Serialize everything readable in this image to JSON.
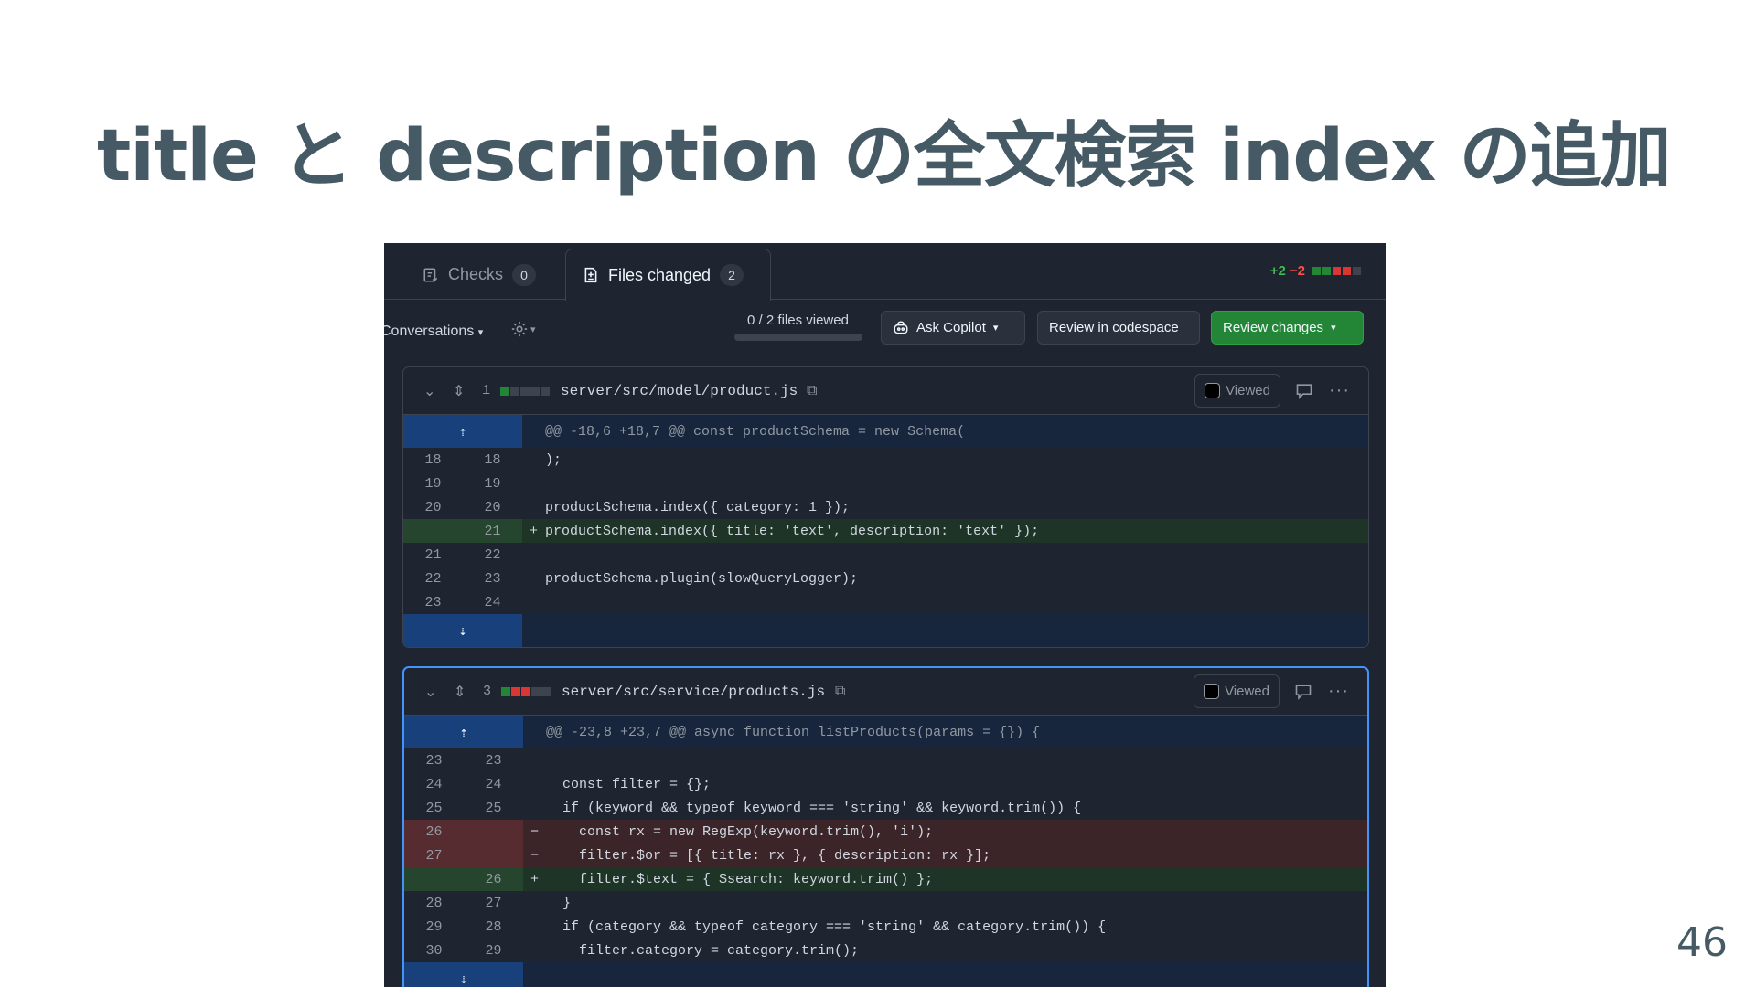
{
  "slide": {
    "title": "title と description の全文検索 index の追加",
    "page_number": "46"
  },
  "tabs": [
    {
      "label": "Checks",
      "count": "0",
      "icon": "checklist-icon"
    },
    {
      "label": "Files changed",
      "count": "2",
      "icon": "file-diff-icon"
    }
  ],
  "diffstat": {
    "additions": "+2",
    "deletions": "−2",
    "colors": {
      "add": "#238636",
      "del": "#da3633",
      "neutral": "#3d444d"
    }
  },
  "toolbar": {
    "conversations": "Conversations",
    "files_viewed": "0 / 2 files viewed",
    "files_viewed_fraction": 0,
    "ask_copilot": "Ask Copilot",
    "review_codespace": "Review in codespace",
    "review_changes": "Review changes",
    "accent": "#238636"
  },
  "files": [
    {
      "changes": "1",
      "path": "server/src/model/product.js",
      "viewed_label": "Viewed",
      "hunk": "@@ -18,6 +18,7 @@ const productSchema = new Schema(",
      "lines": [
        {
          "type": "ctx",
          "old": "18",
          "new": "18",
          "code": ");"
        },
        {
          "type": "ctx",
          "old": "19",
          "new": "19",
          "code": ""
        },
        {
          "type": "ctx",
          "old": "20",
          "new": "20",
          "code": "productSchema.index({ category: 1 });"
        },
        {
          "type": "add",
          "old": "",
          "new": "21",
          "code": "productSchema.index({ title: 'text', description: 'text' });"
        },
        {
          "type": "ctx",
          "old": "21",
          "new": "22",
          "code": ""
        },
        {
          "type": "ctx",
          "old": "22",
          "new": "23",
          "code": "productSchema.plugin(slowQueryLogger);"
        },
        {
          "type": "ctx",
          "old": "23",
          "new": "24",
          "code": ""
        }
      ]
    },
    {
      "changes": "3",
      "path": "server/src/service/products.js",
      "viewed_label": "Viewed",
      "hunk": "@@ -23,8 +23,7 @@ async function listProducts(params = {}) {",
      "lines": [
        {
          "type": "ctx",
          "old": "23",
          "new": "23",
          "code": ""
        },
        {
          "type": "ctx",
          "old": "24",
          "new": "24",
          "code": "  const filter = {};"
        },
        {
          "type": "ctx",
          "old": "25",
          "new": "25",
          "code": "  if (keyword && typeof keyword === 'string' && keyword.trim()) {"
        },
        {
          "type": "del",
          "old": "26",
          "new": "",
          "code": "    const rx = new RegExp(keyword.trim(), 'i');"
        },
        {
          "type": "del",
          "old": "27",
          "new": "",
          "code": "    filter.$or = [{ title: rx }, { description: rx }];"
        },
        {
          "type": "add",
          "old": "",
          "new": "26",
          "code": "    filter.$text = { $search: keyword.trim() };"
        },
        {
          "type": "ctx",
          "old": "28",
          "new": "27",
          "code": "  }"
        },
        {
          "type": "ctx",
          "old": "29",
          "new": "28",
          "code": "  if (category && typeof category === 'string' && category.trim()) {"
        },
        {
          "type": "ctx",
          "old": "30",
          "new": "29",
          "code": "    filter.category = category.trim();"
        }
      ]
    }
  ]
}
